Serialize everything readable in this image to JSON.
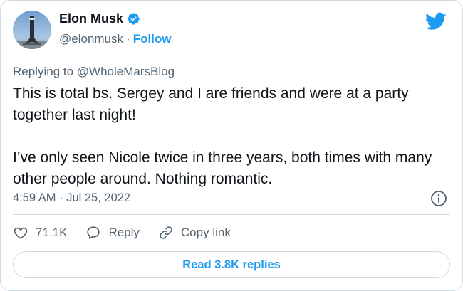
{
  "author": {
    "name": "Elon Musk",
    "handle": "@elonmusk",
    "separator": "·",
    "follow_label": "Follow"
  },
  "tweet": {
    "replying_to": "Replying to @WholeMarsBlog",
    "text": "This is total bs. Sergey and I are friends and were at a party together last night!\n\nI’ve only seen Nicole twice in three years, both times with many other people around. Nothing romantic.",
    "timestamp": "4:59 AM · Jul 25, 2022"
  },
  "actions": {
    "like_count": "71.1K",
    "reply_label": "Reply",
    "copy_link_label": "Copy link"
  },
  "footer": {
    "read_replies_label": "Read 3.8K replies"
  },
  "icons": {
    "verified": "verified-badge-icon",
    "brand": "twitter-bird-icon",
    "info": "info-icon",
    "like": "heart-icon",
    "reply": "speech-bubble-icon",
    "copy_link": "link-icon"
  },
  "colors": {
    "accent": "#1d9bf0",
    "text": "#0f1419",
    "secondary": "#536471",
    "border": "#cfd9de"
  }
}
